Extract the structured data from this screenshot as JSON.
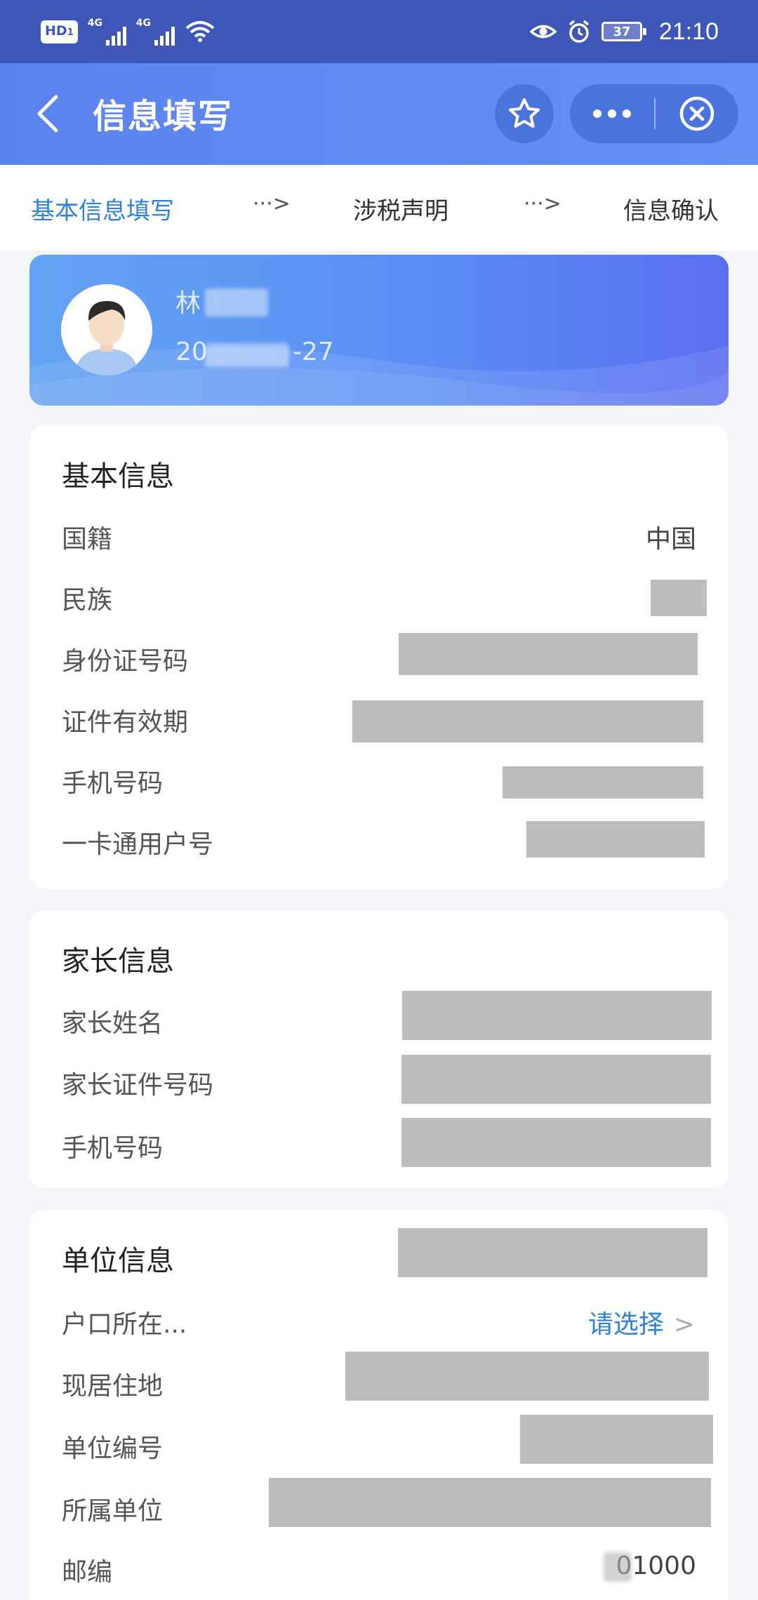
{
  "status_bar": {
    "hd_badge": "HD",
    "hd_sub": "1",
    "signal1_label": "4G",
    "signal2_label": "4G",
    "battery": "37",
    "time": "21:10"
  },
  "title_bar": {
    "title": "信息填写"
  },
  "steps": {
    "step1": "基本信息填写",
    "arrow": "···>",
    "step2": "涉税声明",
    "step3": "信息确认"
  },
  "profile": {
    "name_visible": "林",
    "id_prefix": "20",
    "id_suffix": "-27"
  },
  "basic_info": {
    "title": "基本信息",
    "rows": [
      {
        "label": "国籍",
        "value": "中国"
      },
      {
        "label": "民族",
        "value": ""
      },
      {
        "label": "身份证号码",
        "value": ""
      },
      {
        "label": "证件有效期",
        "value": ""
      },
      {
        "label": "手机号码",
        "value": ""
      },
      {
        "label": "一卡通用户号",
        "value": ""
      }
    ]
  },
  "parent_info": {
    "title": "家长信息",
    "rows": [
      {
        "label": "家长姓名",
        "value": ""
      },
      {
        "label": "家长证件号码",
        "value": ""
      },
      {
        "label": "手机号码",
        "value": ""
      }
    ]
  },
  "unit_info": {
    "title": "单位信息",
    "rows": [
      {
        "label": "户口所在...",
        "value": "请选择"
      },
      {
        "label": "现居住地",
        "value": ""
      },
      {
        "label": "单位编号",
        "value": ""
      },
      {
        "label": "所属单位",
        "value": ""
      },
      {
        "label": "邮编",
        "value": "01000"
      }
    ]
  },
  "colors": {
    "status_bar": "#3f56b9",
    "title_bar": "#6690f4",
    "accent": "#2f82d6",
    "mask": "#bdbdbd"
  }
}
